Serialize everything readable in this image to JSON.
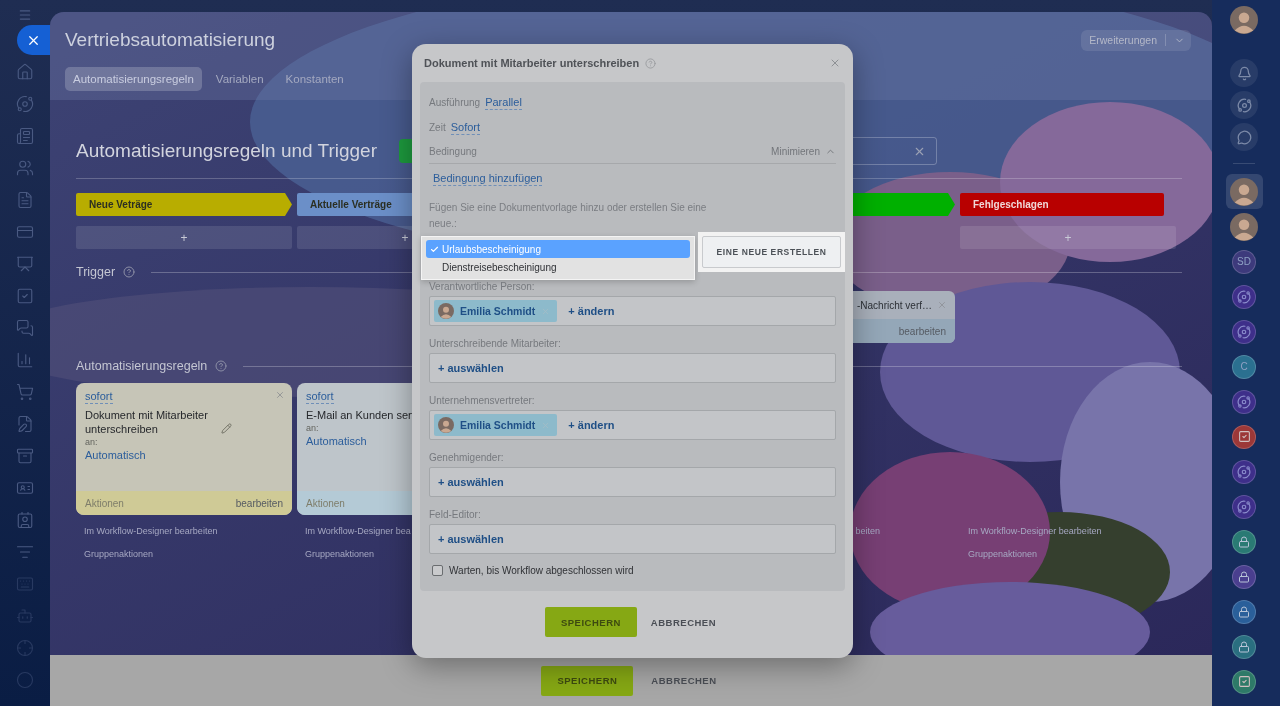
{
  "window": {
    "title": "Vertriebsautomatisierung"
  },
  "header_button": {
    "label": "Erweiterungen"
  },
  "tabs": [
    {
      "label": "Automatisierungsregeln",
      "selected": true
    },
    {
      "label": "Variablen",
      "selected": false
    },
    {
      "label": "Konstanten",
      "selected": false
    }
  ],
  "section_title": "Automatisierungsregeln und Trigger",
  "trigger_title": "Trigger",
  "rules_title": "Automatisierungsregeln",
  "stages": [
    {
      "label": "Neue Veträge",
      "color": "#b8ad00",
      "add": "+",
      "rules": [
        {
          "when": "sofort",
          "title": "Dokument mit Mitarbeiter unterschreiben",
          "editable": true,
          "closable": true,
          "to_label": "an:",
          "to": "Automatisch",
          "footer_left": "Aktionen",
          "footer_right": "bearbeiten",
          "color": "#cfca96"
        }
      ],
      "links": [
        "Im Workflow-Designer bearbeiten",
        "Gruppenaktionen"
      ]
    },
    {
      "label": "Aktuelle Verträge",
      "color": "#6b8fc8",
      "add": "+",
      "rules": [
        {
          "when": "sofort",
          "title": "E-Mail an Kunden sen",
          "to_label": "an:",
          "to": "Automatisch",
          "footer_left": "Aktionen",
          "color": "#b4cad6"
        }
      ],
      "links": [
        "Im Workflow-Designer bea",
        "Gruppenaktionen"
      ]
    },
    {
      "color": "#00b000",
      "clipped": true,
      "triggers": [
        {
          "title": "-Nachricht verf…",
          "action": "bearbeiten"
        }
      ],
      "links": [
        "beiten"
      ]
    },
    {
      "label": "Fehlgeschlagen",
      "color": "#b80000",
      "add": "+",
      "links": [
        "Im Workflow-Designer bearbeiten",
        "Gruppenaktionen"
      ]
    }
  ],
  "dialog": {
    "title": "Dokument mit Mitarbeiter unterschreiben",
    "settings": [
      {
        "label": "Ausführung",
        "value": "Parallel"
      },
      {
        "label": "Zeit",
        "value": "Sofort"
      }
    ],
    "condition": {
      "label": "Bedingung",
      "toggle": "Minimieren",
      "expanded": true,
      "add": "Bedingung hinzufügen"
    },
    "template_hint": "Fügen Sie eine Dokumentvorlage hinzu oder erstellen Sie eine neue.:",
    "template_options": [
      {
        "label": "Urlaubsbescheinigung",
        "selected": true
      },
      {
        "label": "Dienstreisebescheinigung",
        "selected": false
      }
    ],
    "create_button": "EINE NEUE ERSTELLEN",
    "fields": [
      {
        "label": "Verantwortliche Person:",
        "users": [
          {
            "name": "Emilia Schmidt"
          }
        ],
        "action": "+ ändern"
      },
      {
        "label": "Unterschreibende Mitarbeiter:",
        "action": "+ auswählen"
      },
      {
        "label": "Unternehmensvertreter:",
        "users": [
          {
            "name": "Emilia Schmidt"
          }
        ],
        "action": "+ ändern"
      },
      {
        "label": "Genehmigender:",
        "action": "+ auswählen"
      },
      {
        "label": "Feld-Editor:",
        "action": "+ auswählen"
      }
    ],
    "checkbox": {
      "label": "Warten, bis Workflow abgeschlossen wird",
      "checked": false
    },
    "buttons": [
      "SPEICHERN",
      "ABBRECHEN"
    ]
  },
  "footer_buttons": [
    "SPEICHERN",
    "ABBRECHEN"
  ],
  "right_sidebar": [
    {
      "kind": "avatar",
      "selected": true
    },
    {
      "kind": "avatar",
      "selected": false
    },
    {
      "kind": "initials",
      "text": "SD",
      "color": "#3d3a7c",
      "selected": false
    },
    {
      "kind": "channel",
      "color": "#3e2f8a",
      "selected": false
    },
    {
      "kind": "channel",
      "color": "#3e2f8a",
      "selected": false
    },
    {
      "kind": "initials",
      "text": "C",
      "color": "#2b7090",
      "selected": false
    },
    {
      "kind": "channel",
      "color": "#3e2f8a",
      "selected": false
    },
    {
      "kind": "task",
      "color": "#9c3838",
      "selected": false
    },
    {
      "kind": "channel",
      "color": "#3e2f8a",
      "selected": false
    },
    {
      "kind": "channel",
      "color": "#3e2f8a",
      "selected": false
    },
    {
      "kind": "lock",
      "color": "#2a7a74",
      "selected": false
    },
    {
      "kind": "lock",
      "color": "#4a3f8f",
      "selected": false
    },
    {
      "kind": "lock",
      "color": "#2a5f9a",
      "selected": false
    },
    {
      "kind": "lock",
      "color": "#2a6f80",
      "selected": false
    },
    {
      "kind": "task",
      "color": "#2e7a68",
      "selected": false
    }
  ]
}
